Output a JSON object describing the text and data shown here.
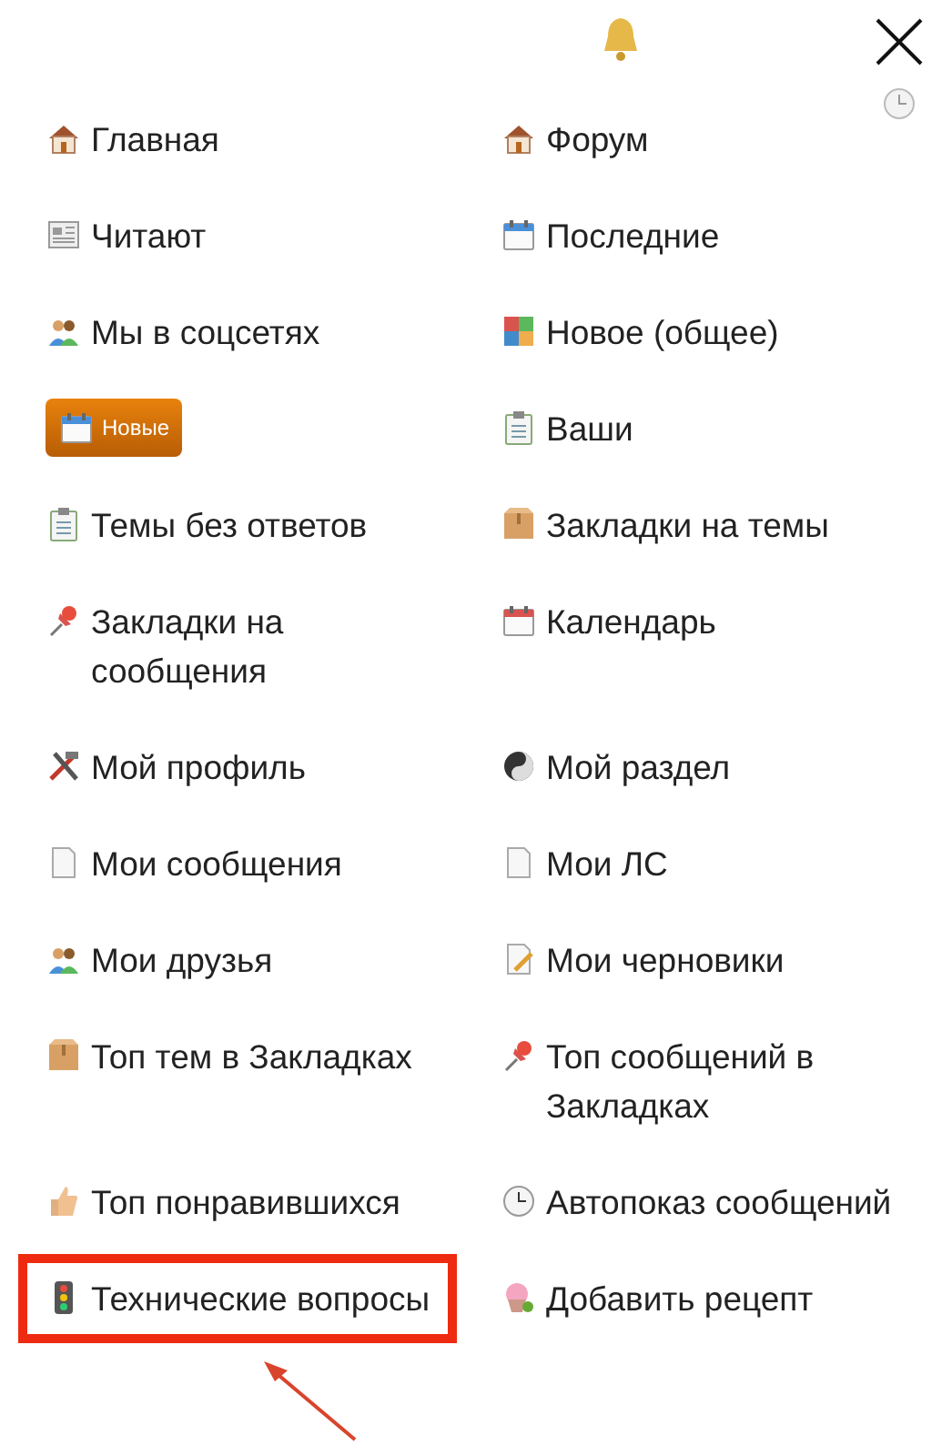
{
  "menu": {
    "items": [
      {
        "label": "Главная",
        "selected": false,
        "highlighted": false
      },
      {
        "label": "Форум",
        "selected": false,
        "highlighted": false
      },
      {
        "label": "Читают",
        "selected": false,
        "highlighted": false
      },
      {
        "label": "Последние",
        "selected": false,
        "highlighted": false
      },
      {
        "label": "Мы в соцсетях",
        "selected": false,
        "highlighted": false
      },
      {
        "label": "Новое (общее)",
        "selected": false,
        "highlighted": false
      },
      {
        "label": "Новые",
        "selected": true,
        "highlighted": false
      },
      {
        "label": "Ваши",
        "selected": false,
        "highlighted": false
      },
      {
        "label": "Темы без ответов",
        "selected": false,
        "highlighted": false
      },
      {
        "label": "Закладки на темы",
        "selected": false,
        "highlighted": false
      },
      {
        "label": "Закладки на сообщения",
        "selected": false,
        "highlighted": false
      },
      {
        "label": "Календарь",
        "selected": false,
        "highlighted": false
      },
      {
        "label": "Мой профиль",
        "selected": false,
        "highlighted": false
      },
      {
        "label": "Мой раздел",
        "selected": false,
        "highlighted": false
      },
      {
        "label": "Мои сообщения",
        "selected": false,
        "highlighted": false
      },
      {
        "label": "Мои ЛС",
        "selected": false,
        "highlighted": false
      },
      {
        "label": "Мои друзья",
        "selected": false,
        "highlighted": false
      },
      {
        "label": "Мои черновики",
        "selected": false,
        "highlighted": false
      },
      {
        "label": "Топ тем в Закладках",
        "selected": false,
        "highlighted": false
      },
      {
        "label": "Топ сообщений в Закладках",
        "selected": false,
        "highlighted": false
      },
      {
        "label": "Топ понравившихся",
        "selected": false,
        "highlighted": false
      },
      {
        "label": "Автопоказ сообщений",
        "selected": false,
        "highlighted": false
      },
      {
        "label": "Технические вопросы",
        "selected": false,
        "highlighted": true
      },
      {
        "label": "Добавить рецепт",
        "selected": false,
        "highlighted": false
      }
    ]
  }
}
